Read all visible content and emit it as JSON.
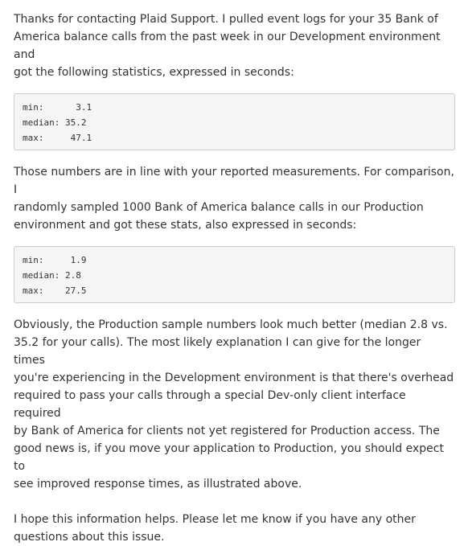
{
  "message": {
    "intro": "Thanks for contacting Plaid Support. I pulled event logs for your 35 Bank of\nAmerica balance calls from the past week in our Development environment and\ngot the following statistics, expressed in seconds:",
    "dev_stats": {
      "min": "min:      3.1",
      "median": "median: 35.2",
      "max": "max:     47.1"
    },
    "comparison": "Those numbers are in line with your reported measurements. For comparison, I\nrandomly sampled 1000 Bank of America balance calls in our Production\nenvironment and got these stats, also expressed in seconds:",
    "prod_stats": {
      "min": "min:     1.9",
      "median": "median: 2.8",
      "max": "max:    27.5"
    },
    "explanation": "Obviously, the Production sample numbers look much better (median 2.8 vs.\n35.2 for your calls). The most likely explanation I can give for the longer times\nyou're experiencing in the Development environment is that there's overhead\nrequired to pass your calls through a special Dev-only client interface required\nby Bank of America for clients not yet registered for Production access. The\ngood news is, if you move your application to Production, you should expect to\nsee improved response times, as illustrated above.",
    "closing": "I hope this information helps. Please let me know if you have any other\nquestions about this issue."
  }
}
